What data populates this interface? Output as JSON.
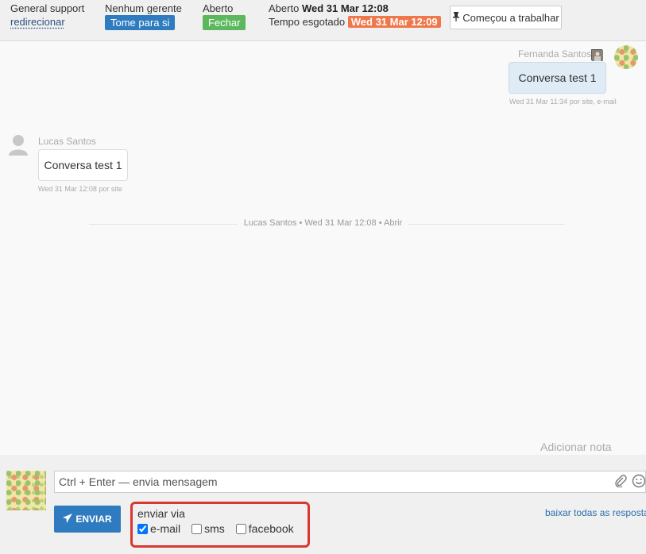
{
  "header": {
    "queue_label": "General support",
    "redirect_link": "redirecionar",
    "manager_label": "Nenhum gerente",
    "take_button": "Tome para si",
    "status_label": "Aberto",
    "close_button": "Fechar",
    "opened_prefix": "Aberto",
    "opened_value": "Wed 31 Mar 12:08",
    "timeout_prefix": "Tempo esgotado",
    "timeout_value": "Wed 31 Mar 12:09",
    "work_button": "Começou a trabalhar",
    "work_icon": "pin-icon"
  },
  "messages": [
    {
      "author": "Fernanda Santos",
      "text": "Conversa test 1",
      "meta": "Wed 31 Mar 11:34 por site, e-mail",
      "direction": "outgoing"
    },
    {
      "author": "Lucas Santos",
      "text": "Conversa test 1",
      "meta": "Wed 31 Mar 12:08 por site",
      "direction": "incoming"
    }
  ],
  "event": {
    "text": "Lucas Santos • Wed 31 Mar 12:08 • Abrir"
  },
  "add_note": "Adicionar nota",
  "composer": {
    "placeholder": "Ctrl + Enter — envia mensagem",
    "send_button": "ENVIAR",
    "via_label": "enviar via",
    "channels": [
      {
        "label": "e-mail",
        "checked": true
      },
      {
        "label": "sms",
        "checked": false
      },
      {
        "label": "facebook",
        "checked": false
      }
    ],
    "download_link": "baixar todas as resposta"
  },
  "colors": {
    "primary": "#2e7bbf",
    "success": "#5cb85c",
    "warning": "#f0774a",
    "highlight": "#d9382f"
  }
}
